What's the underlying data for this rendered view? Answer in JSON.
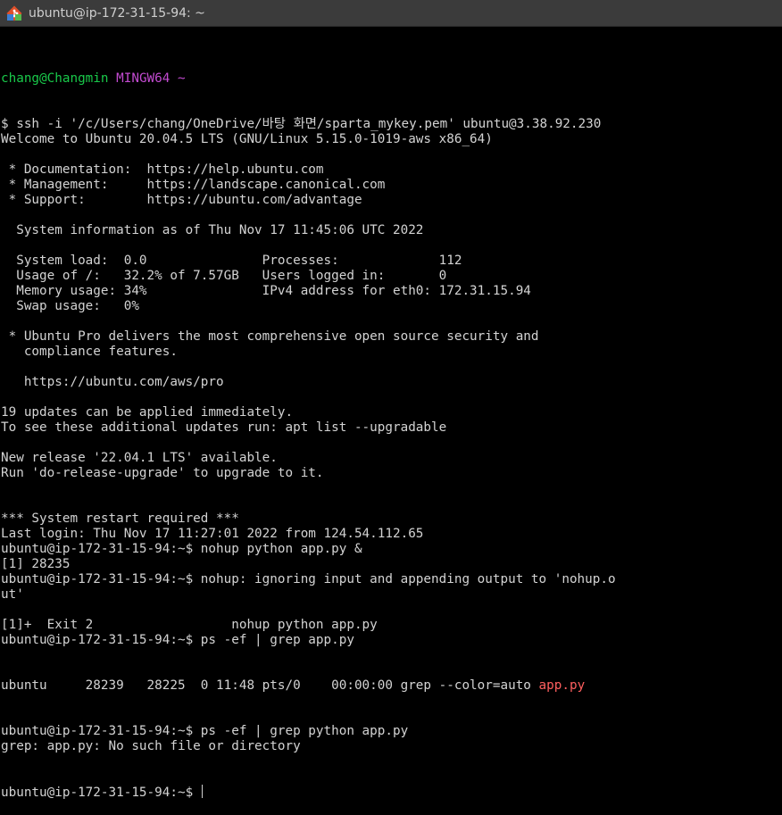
{
  "window": {
    "title": "ubuntu@ip-172-31-15-94: ~",
    "icon": "git-bash-icon"
  },
  "terminal": {
    "prompt_user": "chang@Changmin",
    "prompt_env": "MINGW64",
    "prompt_dir": "~",
    "lines": [
      "$ ssh -i '/c/Users/chang/OneDrive/바탕 화면/sparta_mykey.pem' ubuntu@3.38.92.230",
      "Welcome to Ubuntu 20.04.5 LTS (GNU/Linux 5.15.0-1019-aws x86_64)",
      "",
      " * Documentation:  https://help.ubuntu.com",
      " * Management:     https://landscape.canonical.com",
      " * Support:        https://ubuntu.com/advantage",
      "",
      "  System information as of Thu Nov 17 11:45:06 UTC 2022",
      "",
      "  System load:  0.0               Processes:             112",
      "  Usage of /:   32.2% of 7.57GB   Users logged in:       0",
      "  Memory usage: 34%               IPv4 address for eth0: 172.31.15.94",
      "  Swap usage:   0%",
      "",
      " * Ubuntu Pro delivers the most comprehensive open source security and",
      "   compliance features.",
      "",
      "   https://ubuntu.com/aws/pro",
      "",
      "19 updates can be applied immediately.",
      "To see these additional updates run: apt list --upgradable",
      "",
      "New release '22.04.1 LTS' available.",
      "Run 'do-release-upgrade' to upgrade to it.",
      "",
      "",
      "*** System restart required ***",
      "Last login: Thu Nov 17 11:27:01 2022 from 124.54.112.65",
      "ubuntu@ip-172-31-15-94:~$ nohup python app.py &",
      "[1] 28235",
      "ubuntu@ip-172-31-15-94:~$ nohup: ignoring input and appending output to 'nohup.o",
      "ut'",
      "",
      "[1]+  Exit 2                  nohup python app.py",
      "ubuntu@ip-172-31-15-94:~$ ps -ef | grep app.py"
    ],
    "grep_line_prefix": "ubuntu     28239   28225  0 11:48 pts/0    00:00:00 grep --color=auto ",
    "grep_line_match": "app.py",
    "lines_after": [
      "ubuntu@ip-172-31-15-94:~$ ps -ef | grep python app.py",
      "grep: app.py: No such file or directory"
    ],
    "final_prompt": "ubuntu@ip-172-31-15-94:~$ "
  },
  "colors": {
    "background": "#000000",
    "text": "#d3d3d3",
    "prompt_green": "#19c94a",
    "prompt_magenta": "#c34bd1",
    "grep_match_red": "#ff5f5f"
  }
}
